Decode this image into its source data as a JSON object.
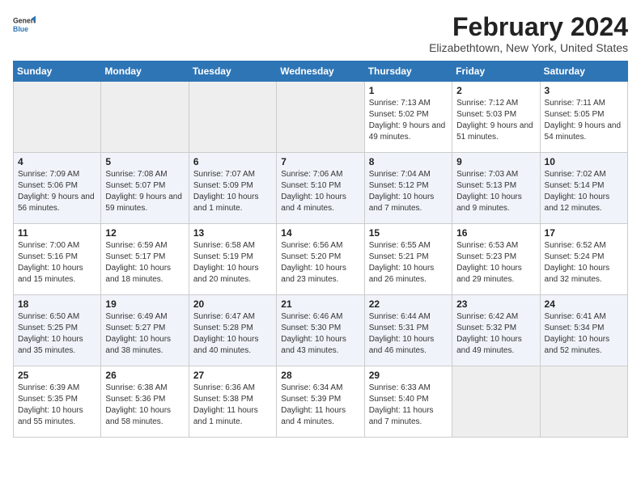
{
  "header": {
    "logo_general": "General",
    "logo_blue": "Blue",
    "month_title": "February 2024",
    "location": "Elizabethtown, New York, United States"
  },
  "weekdays": [
    "Sunday",
    "Monday",
    "Tuesday",
    "Wednesday",
    "Thursday",
    "Friday",
    "Saturday"
  ],
  "weeks": [
    [
      {
        "day": null
      },
      {
        "day": null
      },
      {
        "day": null
      },
      {
        "day": null
      },
      {
        "day": 1,
        "sunrise": "7:13 AM",
        "sunset": "5:02 PM",
        "daylight": "9 hours and 49 minutes."
      },
      {
        "day": 2,
        "sunrise": "7:12 AM",
        "sunset": "5:03 PM",
        "daylight": "9 hours and 51 minutes."
      },
      {
        "day": 3,
        "sunrise": "7:11 AM",
        "sunset": "5:05 PM",
        "daylight": "9 hours and 54 minutes."
      }
    ],
    [
      {
        "day": 4,
        "sunrise": "7:09 AM",
        "sunset": "5:06 PM",
        "daylight": "9 hours and 56 minutes."
      },
      {
        "day": 5,
        "sunrise": "7:08 AM",
        "sunset": "5:07 PM",
        "daylight": "9 hours and 59 minutes."
      },
      {
        "day": 6,
        "sunrise": "7:07 AM",
        "sunset": "5:09 PM",
        "daylight": "10 hours and 1 minute."
      },
      {
        "day": 7,
        "sunrise": "7:06 AM",
        "sunset": "5:10 PM",
        "daylight": "10 hours and 4 minutes."
      },
      {
        "day": 8,
        "sunrise": "7:04 AM",
        "sunset": "5:12 PM",
        "daylight": "10 hours and 7 minutes."
      },
      {
        "day": 9,
        "sunrise": "7:03 AM",
        "sunset": "5:13 PM",
        "daylight": "10 hours and 9 minutes."
      },
      {
        "day": 10,
        "sunrise": "7:02 AM",
        "sunset": "5:14 PM",
        "daylight": "10 hours and 12 minutes."
      }
    ],
    [
      {
        "day": 11,
        "sunrise": "7:00 AM",
        "sunset": "5:16 PM",
        "daylight": "10 hours and 15 minutes."
      },
      {
        "day": 12,
        "sunrise": "6:59 AM",
        "sunset": "5:17 PM",
        "daylight": "10 hours and 18 minutes."
      },
      {
        "day": 13,
        "sunrise": "6:58 AM",
        "sunset": "5:19 PM",
        "daylight": "10 hours and 20 minutes."
      },
      {
        "day": 14,
        "sunrise": "6:56 AM",
        "sunset": "5:20 PM",
        "daylight": "10 hours and 23 minutes."
      },
      {
        "day": 15,
        "sunrise": "6:55 AM",
        "sunset": "5:21 PM",
        "daylight": "10 hours and 26 minutes."
      },
      {
        "day": 16,
        "sunrise": "6:53 AM",
        "sunset": "5:23 PM",
        "daylight": "10 hours and 29 minutes."
      },
      {
        "day": 17,
        "sunrise": "6:52 AM",
        "sunset": "5:24 PM",
        "daylight": "10 hours and 32 minutes."
      }
    ],
    [
      {
        "day": 18,
        "sunrise": "6:50 AM",
        "sunset": "5:25 PM",
        "daylight": "10 hours and 35 minutes."
      },
      {
        "day": 19,
        "sunrise": "6:49 AM",
        "sunset": "5:27 PM",
        "daylight": "10 hours and 38 minutes."
      },
      {
        "day": 20,
        "sunrise": "6:47 AM",
        "sunset": "5:28 PM",
        "daylight": "10 hours and 40 minutes."
      },
      {
        "day": 21,
        "sunrise": "6:46 AM",
        "sunset": "5:30 PM",
        "daylight": "10 hours and 43 minutes."
      },
      {
        "day": 22,
        "sunrise": "6:44 AM",
        "sunset": "5:31 PM",
        "daylight": "10 hours and 46 minutes."
      },
      {
        "day": 23,
        "sunrise": "6:42 AM",
        "sunset": "5:32 PM",
        "daylight": "10 hours and 49 minutes."
      },
      {
        "day": 24,
        "sunrise": "6:41 AM",
        "sunset": "5:34 PM",
        "daylight": "10 hours and 52 minutes."
      }
    ],
    [
      {
        "day": 25,
        "sunrise": "6:39 AM",
        "sunset": "5:35 PM",
        "daylight": "10 hours and 55 minutes."
      },
      {
        "day": 26,
        "sunrise": "6:38 AM",
        "sunset": "5:36 PM",
        "daylight": "10 hours and 58 minutes."
      },
      {
        "day": 27,
        "sunrise": "6:36 AM",
        "sunset": "5:38 PM",
        "daylight": "11 hours and 1 minute."
      },
      {
        "day": 28,
        "sunrise": "6:34 AM",
        "sunset": "5:39 PM",
        "daylight": "11 hours and 4 minutes."
      },
      {
        "day": 29,
        "sunrise": "6:33 AM",
        "sunset": "5:40 PM",
        "daylight": "11 hours and 7 minutes."
      },
      {
        "day": null
      },
      {
        "day": null
      }
    ]
  ],
  "labels": {
    "sunrise": "Sunrise:",
    "sunset": "Sunset:",
    "daylight": "Daylight:"
  }
}
